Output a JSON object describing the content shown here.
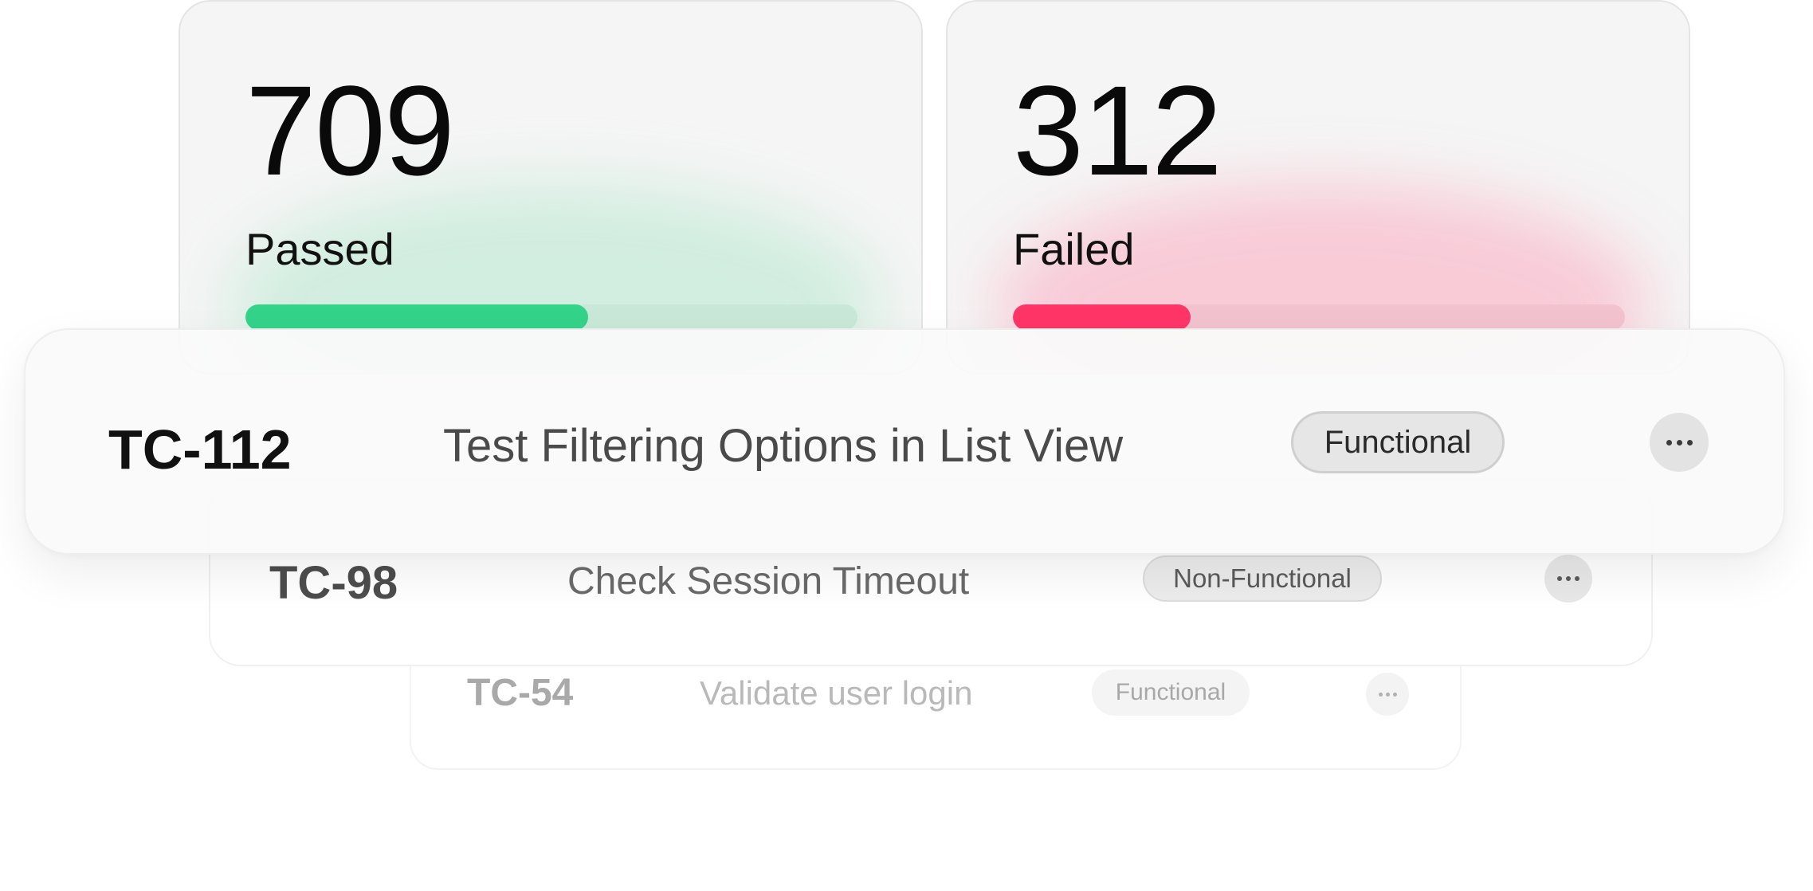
{
  "stats": {
    "passed": {
      "value": "709",
      "label": "Passed",
      "progress": 0.56,
      "accent": "#34d38a"
    },
    "failed": {
      "value": "312",
      "label": "Failed",
      "progress": 0.29,
      "accent": "#ff3568"
    }
  },
  "test_cases": [
    {
      "id": "TC-112",
      "title": "Test Filtering Options in List View",
      "tag": "Functional",
      "more_icon": "more-horizontal-icon"
    },
    {
      "id": "TC-98",
      "title": "Check Session Timeout",
      "tag": "Non-Functional",
      "more_icon": "more-horizontal-icon"
    },
    {
      "id": "TC-54",
      "title": "Validate user login",
      "tag": "Functional",
      "more_icon": "more-horizontal-icon"
    }
  ]
}
